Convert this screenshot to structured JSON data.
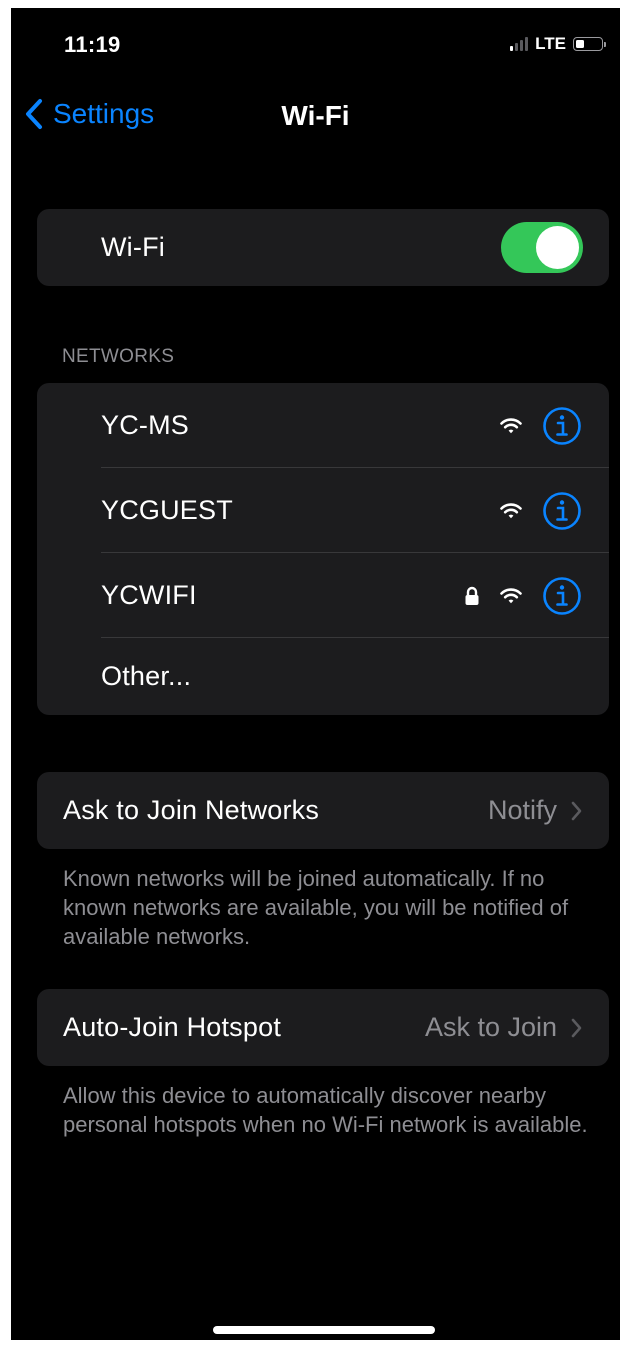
{
  "status_bar": {
    "time": "11:19",
    "network": "LTE",
    "signal_bars_active": 1,
    "signal_bars_total": 4,
    "battery_level": 0.35
  },
  "nav": {
    "back_label": "Settings",
    "title": "Wi-Fi",
    "back_icon": "chevron-left-icon"
  },
  "wifi_toggle": {
    "label": "Wi-Fi",
    "on": true
  },
  "networks": {
    "header": "NETWORKS",
    "items": [
      {
        "name": "YC-MS",
        "locked": false
      },
      {
        "name": "YCGUEST",
        "locked": false
      },
      {
        "name": "YCWIFI",
        "locked": true
      }
    ],
    "other_label": "Other..."
  },
  "ask_to_join": {
    "label": "Ask to Join Networks",
    "value": "Notify",
    "footnote": "Known networks will be joined automatically. If no known networks are available, you will be notified of available networks."
  },
  "auto_join_hotspot": {
    "label": "Auto-Join Hotspot",
    "value": "Ask to Join",
    "footnote": "Allow this device to automatically discover nearby personal hotspots when no Wi-Fi network is available."
  },
  "colors": {
    "accent": "#0a84ff",
    "toggle_on": "#34c759",
    "cell_background": "#1c1c1e",
    "secondary_text": "#8e8e93"
  }
}
